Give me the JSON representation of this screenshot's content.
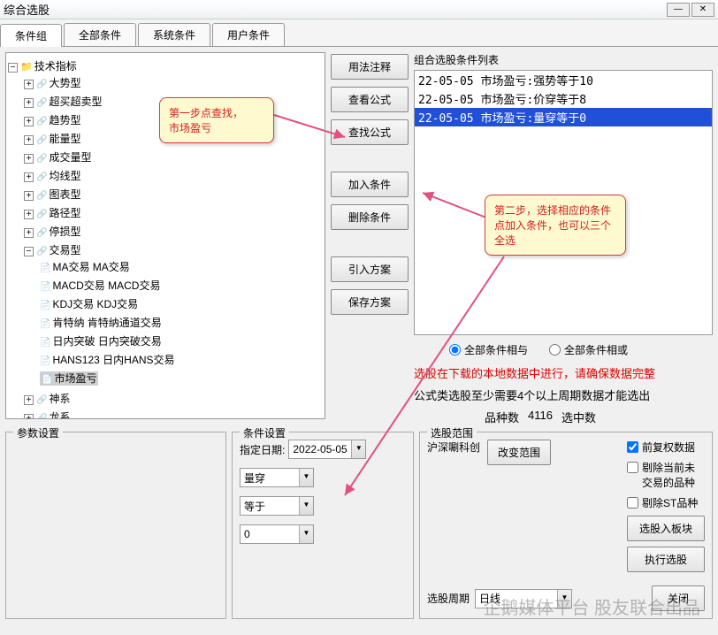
{
  "window": {
    "title": "综合选股"
  },
  "tabs": [
    "条件组",
    "全部条件",
    "系统条件",
    "用户条件"
  ],
  "tree": {
    "root": "技术指标",
    "cats": [
      "大势型",
      "超买超卖型",
      "趋势型",
      "能量型",
      "成交量型",
      "均线型",
      "图表型",
      "路径型",
      "停损型"
    ],
    "trade": {
      "label": "交易型",
      "items": [
        "MA交易 MA交易",
        "MACD交易 MACD交易",
        "KDJ交易 KDJ交易",
        "肯特纳 肯特纳通道交易",
        "日内突破 日内突破交易",
        "HANS123 日内HANS交易",
        "市场盈亏"
      ]
    },
    "post": [
      "神系",
      "龙系"
    ]
  },
  "mid_buttons": [
    "用法注释",
    "查看公式",
    "查找公式",
    "加入条件",
    "删除条件",
    "引入方案",
    "保存方案"
  ],
  "combo": {
    "label": "组合选股条件列表",
    "rows": [
      "22-05-05 市场盈亏:强势等于10",
      "22-05-05 市场盈亏:价穿等于8",
      "22-05-05 市场盈亏:量穿等于0"
    ]
  },
  "radios": {
    "and": "全部条件相与",
    "or": "全部条件相或"
  },
  "warn": "选股在下载的本地数据中进行，请确保数据完整",
  "info": "公式类选股至少需要4个以上周期数据才能选出",
  "counts": {
    "varieties_label": "品种数",
    "varieties": "4116",
    "selected_label": "选中数",
    "selected": ""
  },
  "groups": {
    "param": "参数设置",
    "cond": "条件设置",
    "scope": "选股范围"
  },
  "cond": {
    "date_label": "指定日期:",
    "date": "2022-05-05",
    "field": "量穿",
    "op": "等于",
    "value": "0"
  },
  "scope": {
    "market": "沪深唰科创",
    "change_btn": "改变范围",
    "chk_fq": "前复权数据",
    "chk_rm_notrade": "剔除当前未交易的品种",
    "chk_rm_st": "剔除ST品种",
    "btn_block": "选股入板块",
    "btn_exec": "执行选股",
    "period_label": "选股周期",
    "period": "日线",
    "btn_close": "关闭"
  },
  "callouts": {
    "c1": "第一步点查找，\n市场盈亏",
    "c2": "第二步，选择相应的条件点加入条件，也可以三个全选"
  },
  "watermark": "企鹅媒体平台 股友联合出品"
}
